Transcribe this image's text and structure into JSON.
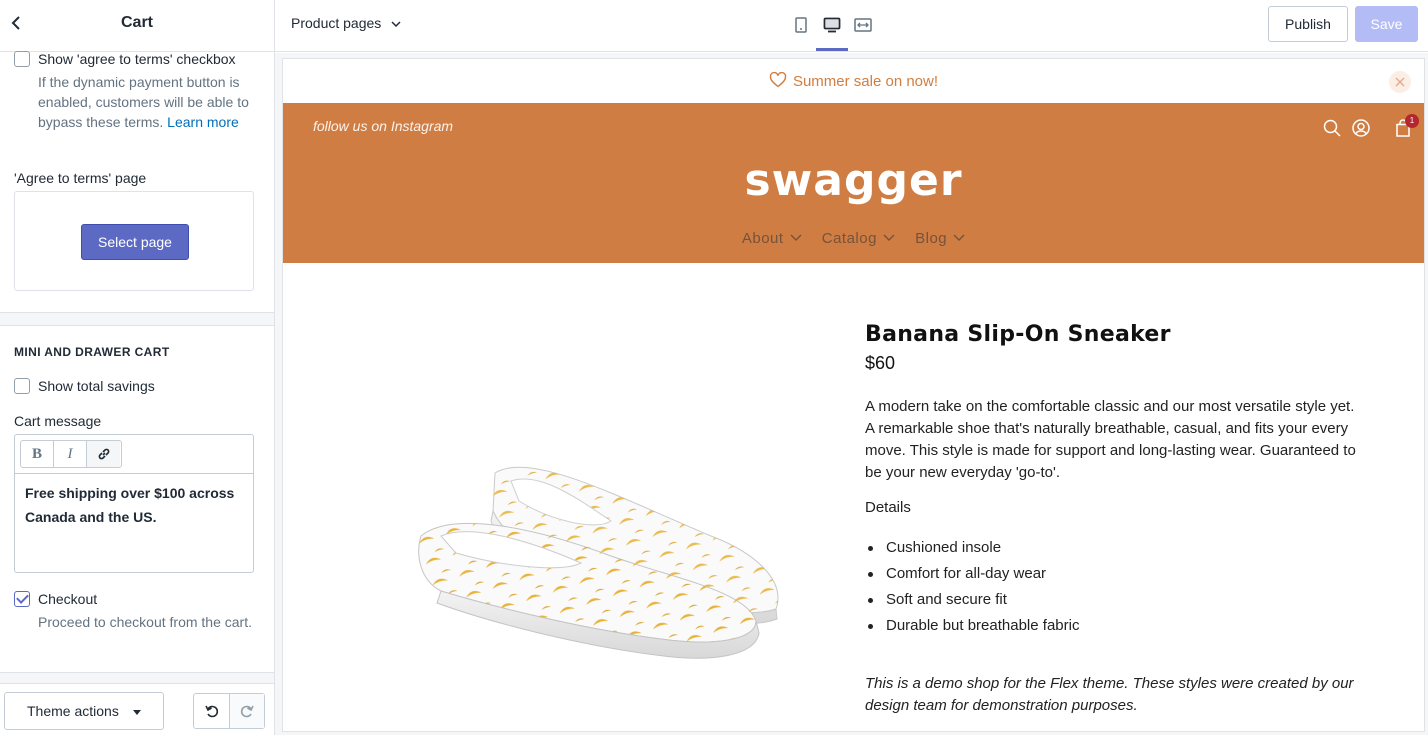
{
  "sidebar": {
    "title": "Cart",
    "agree_terms_checkbox_label": "Show 'agree to terms' checkbox",
    "agree_terms_help": "If the dynamic payment button is enabled, customers will be able to bypass these terms.",
    "agree_terms_help_link": "Learn more",
    "agree_terms_page_label": "'Agree to terms' page",
    "select_page_button": "Select page",
    "mini_cart_section_title": "MINI AND DRAWER CART",
    "show_total_savings_label": "Show total savings",
    "cart_message_label": "Cart message",
    "cart_message_value": "Free shipping over $100 across Canada and the US.",
    "rte_bold": "B",
    "rte_italic": "I",
    "checkout_label": "Checkout",
    "checkout_help": "Proceed to checkout from the cart.",
    "checkout_checked": true,
    "show_total_savings_checked": false,
    "agree_terms_checked": false,
    "theme_actions_label": "Theme actions"
  },
  "topbar": {
    "page_selector": "Product pages",
    "publish_label": "Publish",
    "save_label": "Save"
  },
  "store": {
    "announcement": "Summer sale on now!",
    "instagram_link": "follow us on Instagram",
    "logo": "swagger",
    "nav": [
      "About",
      "Catalog",
      "Blog"
    ],
    "cart_count": "1",
    "accent_color": "#cf7d43",
    "announcement_color": "#d07e3f"
  },
  "product": {
    "title": "Banana Slip-On Sneaker",
    "price": "$60",
    "description": "A modern take on the comfortable classic and our most versatile style yet. A remarkable shoe that's naturally breathable, casual, and fits your every move. This style is made for support and long-lasting wear. Guaranteed to be your new everyday 'go-to'.",
    "details_label": "Details",
    "details": [
      "Cushioned insole",
      "Comfort for all-day wear",
      "Soft and secure fit",
      "Durable but breathable fabric"
    ],
    "demo_note": "This is a demo shop for the Flex theme. These styles were created by our design team for demonstration purposes."
  }
}
